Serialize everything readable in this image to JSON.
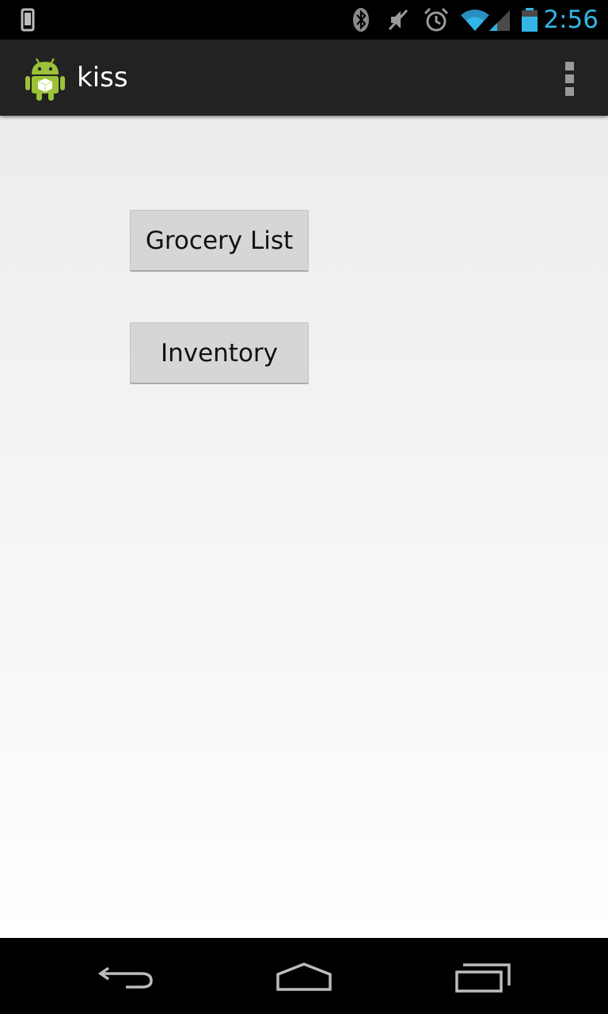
{
  "status_bar": {
    "time": "2:56",
    "icons": [
      "phone-vibrate-icon",
      "bluetooth-icon",
      "mute-icon",
      "alarm-icon",
      "wifi-icon",
      "signal-icon",
      "battery-icon"
    ],
    "time_color": "#33b5e5"
  },
  "action_bar": {
    "title": "kiss",
    "app_icon": "android-robot-icon",
    "overflow_icon": "overflow-menu-icon",
    "background": "#222222"
  },
  "main": {
    "buttons": [
      {
        "label": "Grocery List"
      },
      {
        "label": "Inventory"
      }
    ]
  },
  "nav_bar": {
    "icons": [
      "back-icon",
      "home-icon",
      "recent-apps-icon"
    ]
  }
}
